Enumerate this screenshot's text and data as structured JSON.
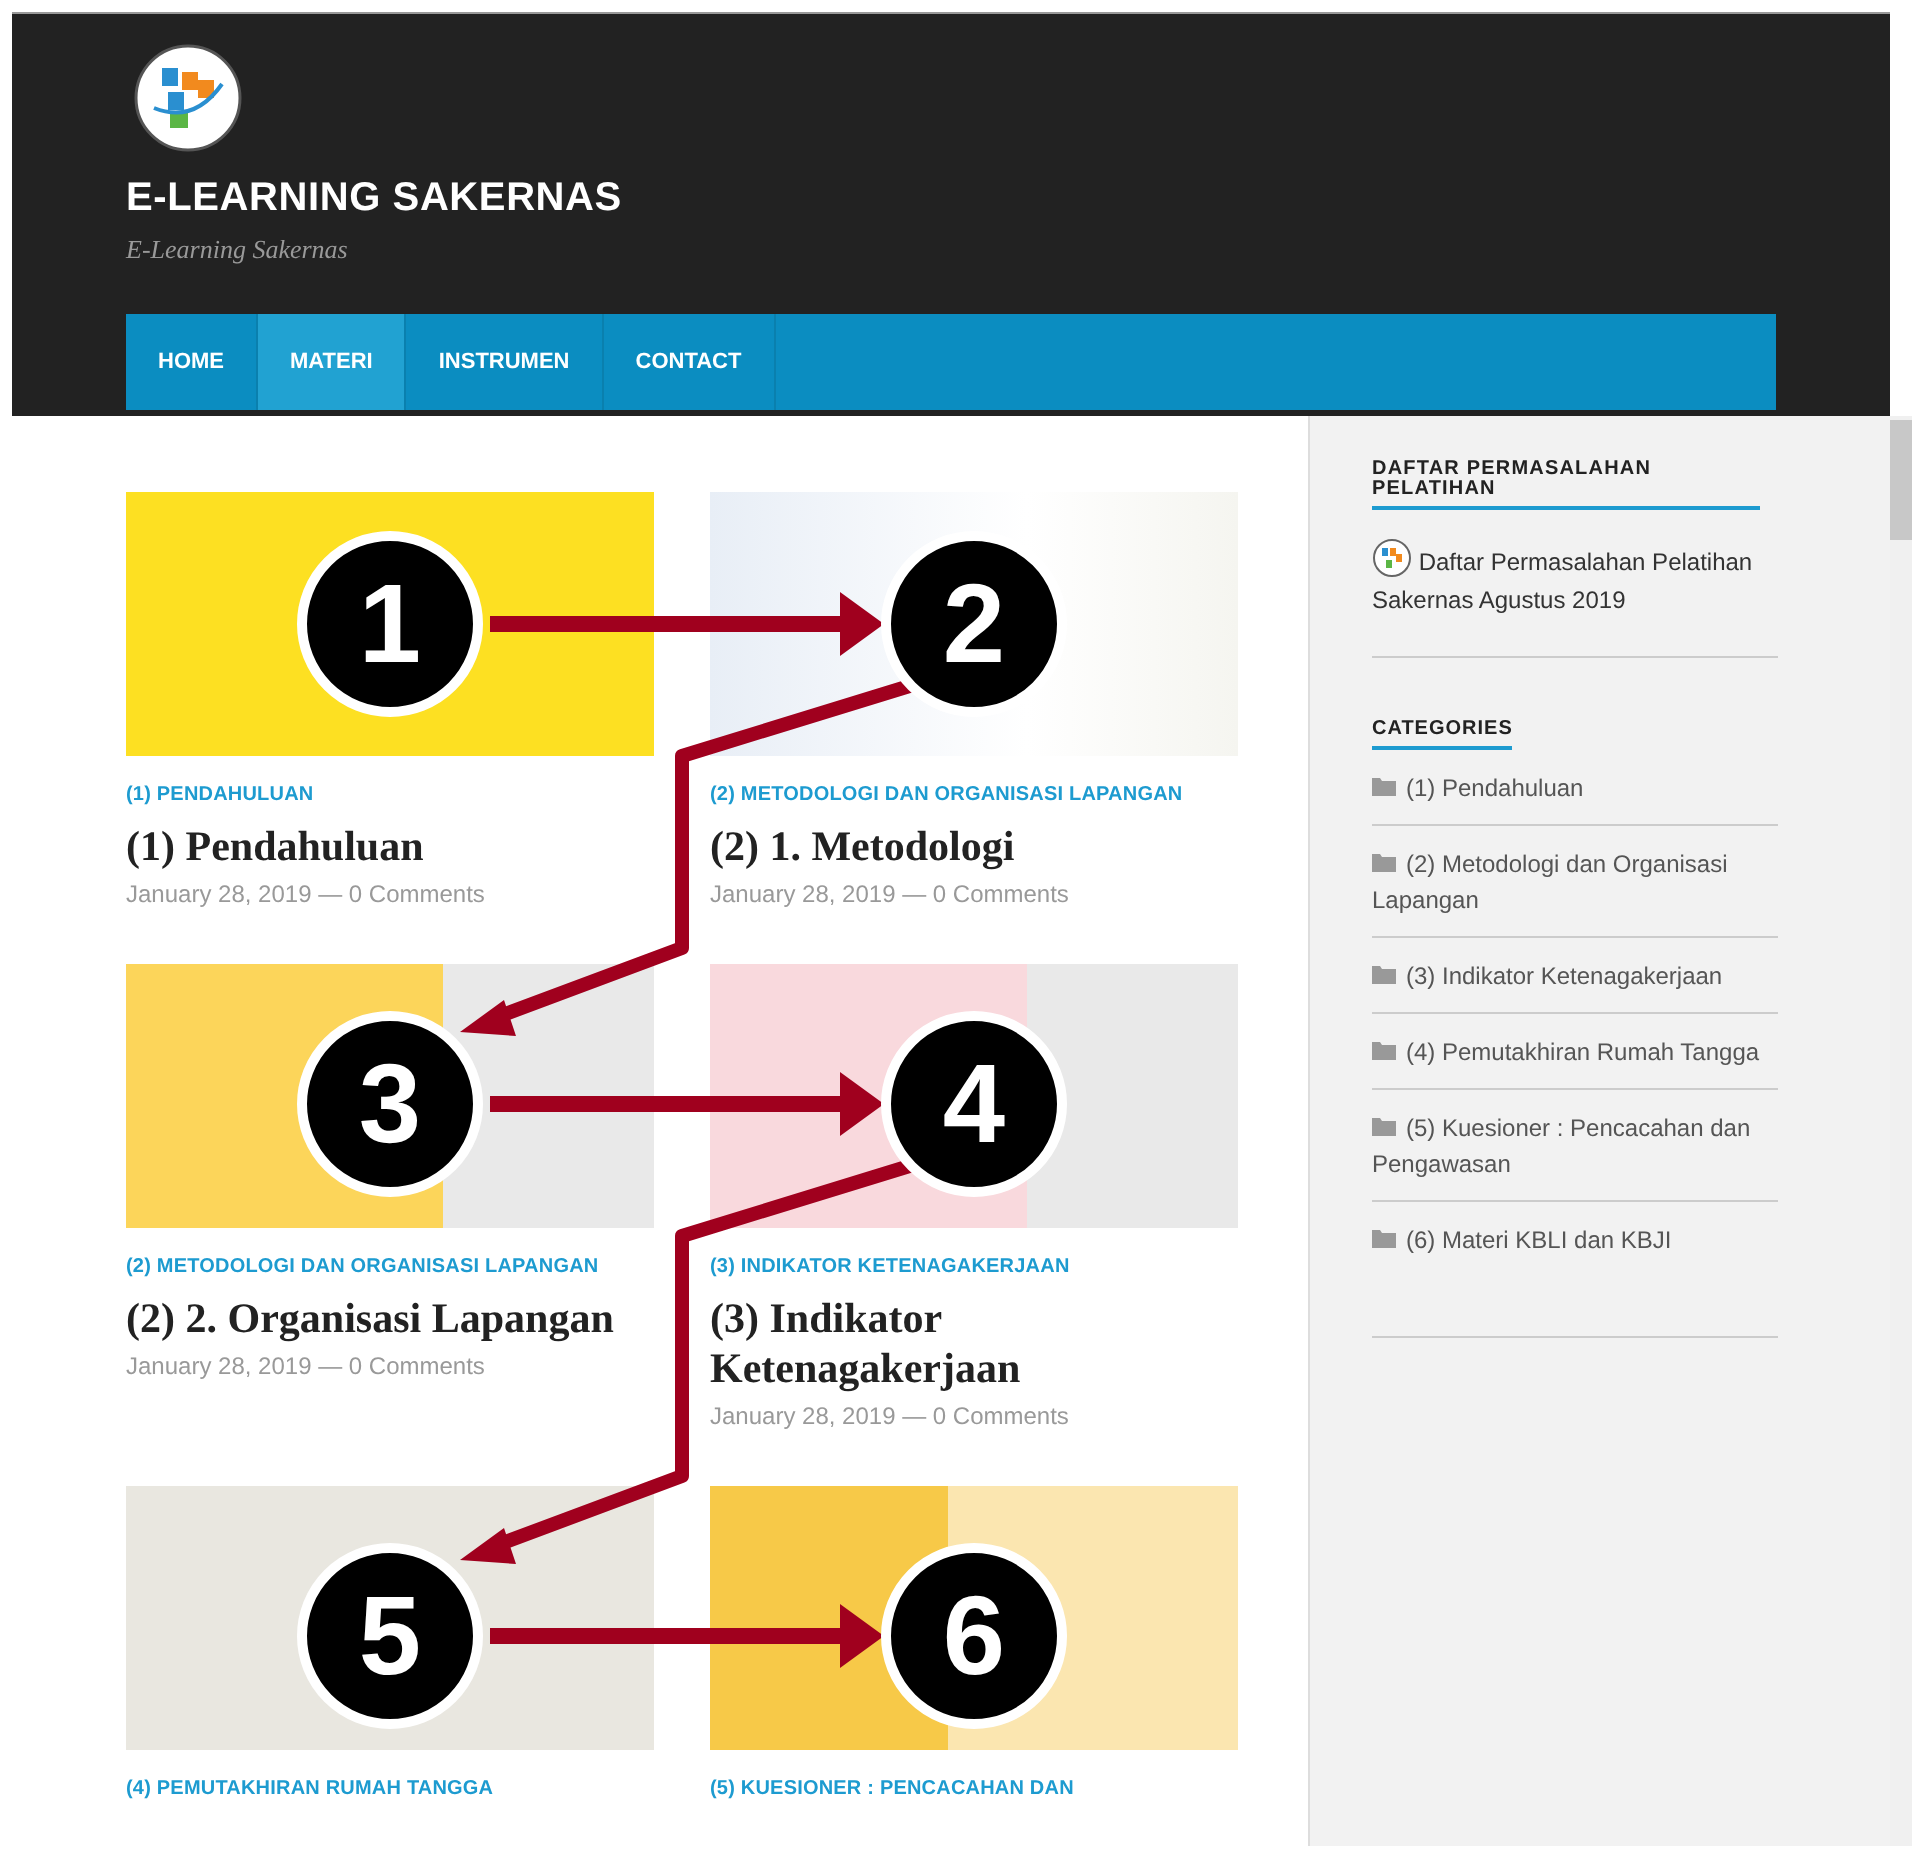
{
  "site": {
    "title": "E-LEARNING SAKERNAS",
    "tagline": "E-Learning Sakernas"
  },
  "nav": [
    {
      "label": "HOME",
      "selected": false
    },
    {
      "label": "MATERI",
      "selected": true
    },
    {
      "label": "INSTRUMEN",
      "selected": false
    },
    {
      "label": "CONTACT",
      "selected": false
    }
  ],
  "posts": [
    {
      "category": "(1) PENDAHULUAN",
      "title": "(1) Pendahuluan",
      "meta": "January 28, 2019 — 0 Comments"
    },
    {
      "category": "(2) METODOLOGI DAN ORGANISASI LAPANGAN",
      "title": "(2) 1. Metodologi",
      "meta": "January 28, 2019 — 0 Comments"
    },
    {
      "category": "(2) METODOLOGI DAN ORGANISASI LAPANGAN",
      "title": "(2) 2. Organisasi Lapangan",
      "meta": "January 28, 2019 — 0 Comments"
    },
    {
      "category": "(3) INDIKATOR KETENAGAKERJAAN",
      "title": "(3) Indikator Ketenagakerjaan",
      "meta": "January 28, 2019 — 0 Comments"
    },
    {
      "category": "(4) PEMUTAKHIRAN RUMAH TANGGA"
    },
    {
      "category": "(5) KUESIONER : PENCACAHAN DAN"
    }
  ],
  "sidebar": {
    "widget": {
      "title": "DAFTAR PERMASALAHAN PELATIHAN",
      "link": "Daftar Permasalahan Pelatihan Sakernas Agustus 2019"
    },
    "categories": {
      "title": "CATEGORIES",
      "items": [
        "(1) Pendahuluan",
        "(2) Metodologi dan Organisasi Lapangan",
        "(3) Indikator Ketenagakerjaan",
        "(4) Pemutakhiran Rumah Tangga",
        "(5) Kuesioner : Pencacahan dan Pengawasan",
        "(6) Materi KBLI dan KBJI"
      ]
    }
  },
  "steps": [
    "1",
    "2",
    "3",
    "4",
    "5",
    "6"
  ]
}
